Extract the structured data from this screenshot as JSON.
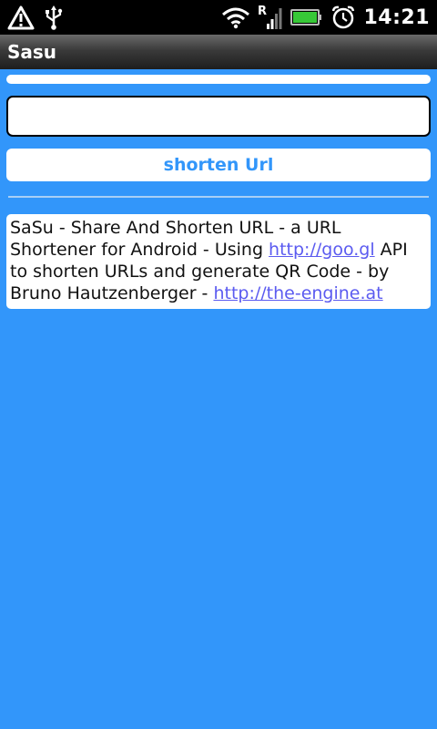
{
  "status_bar": {
    "time": "14:21",
    "icons": [
      "warning-icon",
      "usb-icon",
      "wifi-icon",
      "signal-icon",
      "battery-icon",
      "alarm-icon"
    ]
  },
  "app": {
    "title": "Sasu"
  },
  "form": {
    "url_value": "",
    "url_placeholder": "",
    "shorten_label": "shorten Url"
  },
  "info": {
    "text_1": "SaSu - Share And Shorten URL - a URL Shortener for Android - Using ",
    "link_1": "http://goo.gl",
    "text_2": " API to shorten URLs and generate QR Code - by Bruno Hautzenberger - ",
    "link_2": "http://the-engine.at"
  },
  "colors": {
    "background": "#3296FA",
    "button_text": "#3296FA",
    "link": "#5b5bf0"
  }
}
